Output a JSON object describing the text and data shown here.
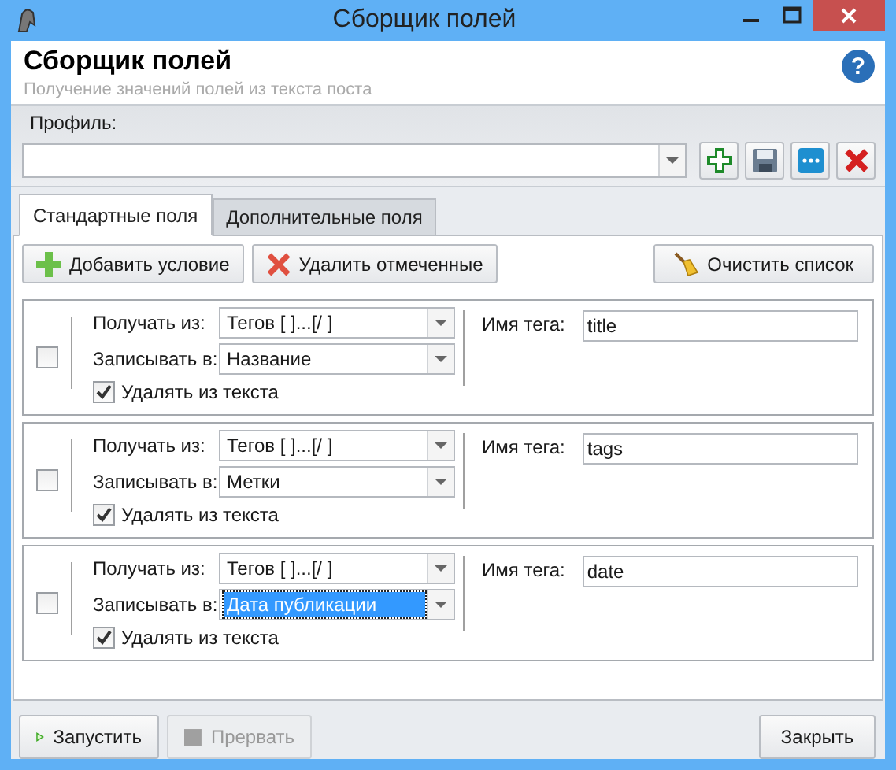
{
  "window": {
    "title": "Сборщик полей"
  },
  "header": {
    "title": "Сборщик полей",
    "subtitle": "Получение значений полей из текста поста"
  },
  "help": {
    "label": "?"
  },
  "profile": {
    "label": "Профиль:"
  },
  "tabs": [
    {
      "label": "Стандартные поля",
      "selected": true
    },
    {
      "label": "Дополнительные поля",
      "selected": false
    }
  ],
  "toolbar": [
    {
      "label": "Добавить условие",
      "kind": "add"
    },
    {
      "label": "Удалить отмеченные",
      "kind": "delete"
    },
    {
      "label": "Очистить список",
      "kind": "clear"
    }
  ],
  "conditions": [
    {
      "checked": false,
      "source_label": "Получать из:",
      "source": "Тегов [ ]...[/ ]",
      "target_label": "Записывать в:",
      "target": "Название",
      "target_focused": false,
      "remove_label": "Удалять из текста",
      "remove": true,
      "tag_label": "Имя тега:",
      "tag": "title"
    },
    {
      "checked": false,
      "source_label": "Получать из:",
      "source": "Тегов [ ]...[/ ]",
      "target_label": "Записывать в:",
      "target": "Метки",
      "target_focused": false,
      "remove_label": "Удалять из текста",
      "remove": true,
      "tag_label": "Имя тега:",
      "tag": "tags"
    },
    {
      "checked": false,
      "source_label": "Получать из:",
      "source": "Тегов [ ]...[/ ]",
      "target_label": "Записывать в:",
      "target": "Дата публикации",
      "target_focused": true,
      "remove_label": "Удалять из текста",
      "remove": true,
      "tag_label": "Имя тега:",
      "tag": "date"
    }
  ],
  "footer": [
    {
      "label": "Запустить",
      "kind": "run",
      "disabled": false
    },
    {
      "label": "Прервать",
      "kind": "stop",
      "disabled": true
    },
    {
      "label": "Закрыть",
      "kind": "close",
      "disabled": false
    }
  ]
}
